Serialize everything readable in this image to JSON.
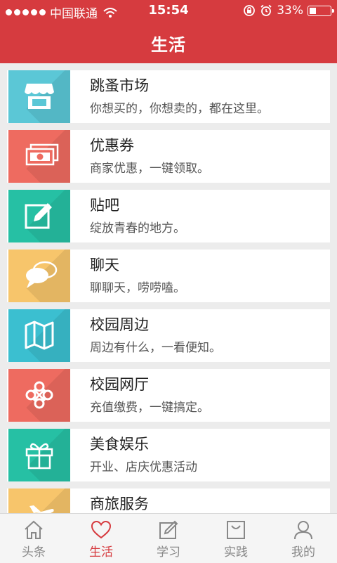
{
  "status_bar": {
    "carrier": "中国联通",
    "time": "15:54",
    "battery": "33%",
    "battery_level": 0.33
  },
  "header": {
    "title": "生活"
  },
  "items": [
    {
      "name": "跳蚤市场",
      "desc": "你想买的，你想卖的，都在这里。",
      "icon": "shop-icon",
      "color": "#5bc7d6"
    },
    {
      "name": "优惠券",
      "desc": "商家优惠，一键领取。",
      "icon": "money-icon",
      "color": "#ee6b60"
    },
    {
      "name": "贴吧",
      "desc": "绽放青春的地方。",
      "icon": "edit-icon",
      "color": "#26c0a4"
    },
    {
      "name": "聊天",
      "desc": "聊聊天，唠唠嗑。",
      "icon": "chat-icon",
      "color": "#f7c56b"
    },
    {
      "name": "校园周边",
      "desc": "周边有什么，一看便知。",
      "icon": "map-icon",
      "color": "#3bbfd0"
    },
    {
      "name": "校园网厅",
      "desc": "充值缴费，一键搞定。",
      "icon": "unicom-logo-icon",
      "color": "#ee6b60"
    },
    {
      "name": "美食娱乐",
      "desc": "开业、店庆优惠活动",
      "icon": "gift-icon",
      "color": "#26c0a4"
    },
    {
      "name": "商旅服务",
      "desc": "",
      "icon": "plane-icon",
      "color": "#f7c56b"
    }
  ],
  "tabs": [
    {
      "label": "头条",
      "icon": "home-icon",
      "active": false
    },
    {
      "label": "生活",
      "icon": "heart-icon",
      "active": true
    },
    {
      "label": "学习",
      "icon": "pencil-icon",
      "active": false
    },
    {
      "label": "实践",
      "icon": "bag-icon",
      "active": false
    },
    {
      "label": "我的",
      "icon": "person-icon",
      "active": false
    }
  ],
  "colors": {
    "header": "#d63b3f",
    "active_tab": "#d63b3f",
    "inactive_tab": "#888888"
  }
}
